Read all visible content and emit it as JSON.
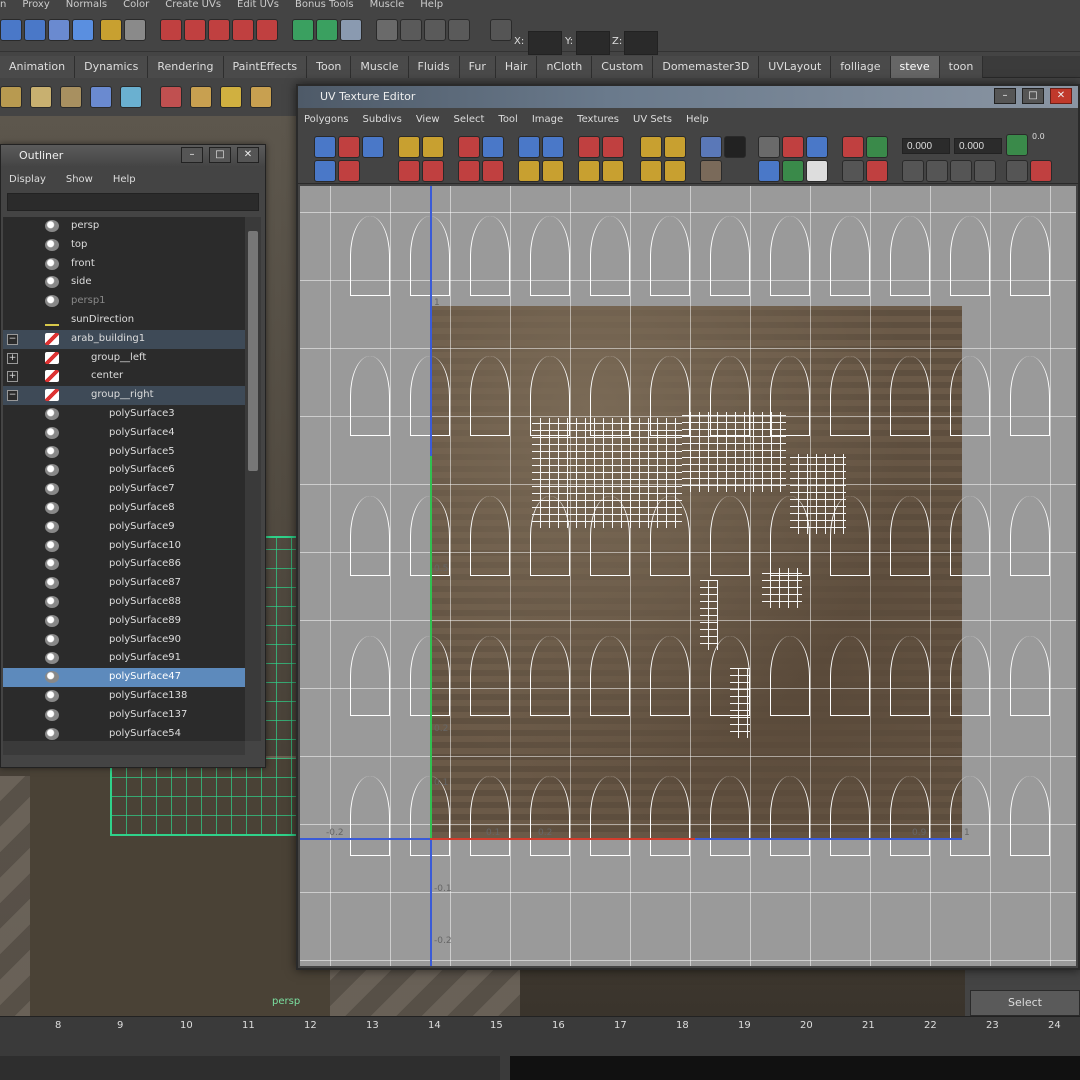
{
  "menubar": {
    "items": [
      "n",
      "Proxy",
      "Normals",
      "Color",
      "Create UVs",
      "Edit UVs",
      "Bonus Tools",
      "Muscle",
      "Help"
    ]
  },
  "statusline": {
    "x_label": "X:",
    "y_label": "Y:",
    "z_label": "Z:"
  },
  "shelf_tabs": [
    {
      "label": "Animation"
    },
    {
      "label": "Dynamics"
    },
    {
      "label": "Rendering"
    },
    {
      "label": "PaintEffects"
    },
    {
      "label": "Toon"
    },
    {
      "label": "Muscle"
    },
    {
      "label": "Fluids"
    },
    {
      "label": "Fur"
    },
    {
      "label": "Hair"
    },
    {
      "label": "nCloth"
    },
    {
      "label": "Custom"
    },
    {
      "label": "Domemaster3D"
    },
    {
      "label": "UVLayout"
    },
    {
      "label": "folliage"
    },
    {
      "label": "steve"
    },
    {
      "label": "toon"
    }
  ],
  "active_shelf_tab": "steve",
  "viewport": {
    "camera_label": "persp"
  },
  "outliner": {
    "title": "Outliner",
    "menu": [
      "Display",
      "Show",
      "Help"
    ],
    "items": [
      {
        "label": "persp",
        "icon": "camera-icon",
        "level": 0,
        "state": "normal"
      },
      {
        "label": "top",
        "icon": "camera-icon",
        "level": 0,
        "state": "normal"
      },
      {
        "label": "front",
        "icon": "camera-icon",
        "level": 0,
        "state": "normal"
      },
      {
        "label": "side",
        "icon": "camera-icon",
        "level": 0,
        "state": "normal"
      },
      {
        "label": "persp1",
        "icon": "camera-icon",
        "level": 0,
        "state": "dim"
      },
      {
        "label": "sunDirection",
        "icon": "light-icon",
        "level": 0,
        "state": "normal"
      },
      {
        "label": "arab_building1",
        "icon": "group-icon",
        "level": 0,
        "state": "highlight",
        "expand": "−"
      },
      {
        "label": "group__left",
        "icon": "group-icon",
        "level": 1,
        "state": "normal",
        "expand": "+"
      },
      {
        "label": "center",
        "icon": "group-icon",
        "level": 1,
        "state": "normal",
        "expand": "+"
      },
      {
        "label": "group__right",
        "icon": "group-icon",
        "level": 1,
        "state": "highlight",
        "expand": "−"
      },
      {
        "label": "polySurface3",
        "icon": "mesh-icon",
        "level": 2,
        "state": "normal"
      },
      {
        "label": "polySurface4",
        "icon": "mesh-icon",
        "level": 2,
        "state": "normal"
      },
      {
        "label": "polySurface5",
        "icon": "mesh-icon",
        "level": 2,
        "state": "normal"
      },
      {
        "label": "polySurface6",
        "icon": "mesh-icon",
        "level": 2,
        "state": "normal"
      },
      {
        "label": "polySurface7",
        "icon": "mesh-icon",
        "level": 2,
        "state": "normal"
      },
      {
        "label": "polySurface8",
        "icon": "mesh-icon",
        "level": 2,
        "state": "normal"
      },
      {
        "label": "polySurface9",
        "icon": "mesh-icon",
        "level": 2,
        "state": "normal"
      },
      {
        "label": "polySurface10",
        "icon": "mesh-icon",
        "level": 2,
        "state": "normal"
      },
      {
        "label": "polySurface86",
        "icon": "mesh-icon",
        "level": 2,
        "state": "normal"
      },
      {
        "label": "polySurface87",
        "icon": "mesh-icon",
        "level": 2,
        "state": "normal"
      },
      {
        "label": "polySurface88",
        "icon": "mesh-icon",
        "level": 2,
        "state": "normal"
      },
      {
        "label": "polySurface89",
        "icon": "mesh-icon",
        "level": 2,
        "state": "normal"
      },
      {
        "label": "polySurface90",
        "icon": "mesh-icon",
        "level": 2,
        "state": "normal"
      },
      {
        "label": "polySurface91",
        "icon": "mesh-icon",
        "level": 2,
        "state": "normal"
      },
      {
        "label": "polySurface47",
        "icon": "mesh-icon",
        "level": 2,
        "state": "selected"
      },
      {
        "label": "polySurface138",
        "icon": "mesh-icon",
        "level": 2,
        "state": "normal"
      },
      {
        "label": "polySurface137",
        "icon": "mesh-icon",
        "level": 2,
        "state": "normal"
      },
      {
        "label": "polySurface54",
        "icon": "mesh-icon",
        "level": 2,
        "state": "normal"
      }
    ]
  },
  "uv_editor": {
    "title": "UV Texture Editor",
    "menu": [
      "Polygons",
      "Subdivs",
      "View",
      "Select",
      "Tool",
      "Image",
      "Textures",
      "UV Sets",
      "Help"
    ],
    "u_value": "0.000",
    "v_value": "0.000",
    "step_label": "0.0",
    "axis_labels": [
      "1",
      "0.5",
      "0.2",
      "0.1",
      "-0.1",
      "-0.2",
      "-0.2",
      "0.1",
      "0.2",
      "0.9",
      "1"
    ]
  },
  "select_button": "Select",
  "timeline": {
    "ticks": [
      "8",
      "9",
      "10",
      "11",
      "12",
      "13",
      "14",
      "15",
      "16",
      "17",
      "18",
      "19",
      "20",
      "21",
      "22",
      "23",
      "24"
    ]
  },
  "colors": {
    "accent_blue": "#5d8abc",
    "wire_green": "#2fd28a",
    "u_axis": "#3a5bd8",
    "v_axis": "#30c050",
    "red_axis": "#d23c2c"
  }
}
